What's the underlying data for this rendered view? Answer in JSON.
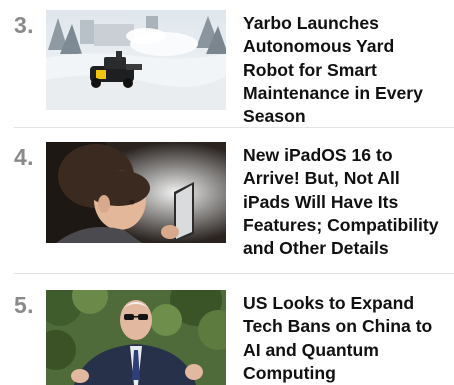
{
  "articles": [
    {
      "rank": "3.",
      "headline": "Yarbo Launches Autonomous Yard Robot for Smart Maintenance in Every Season",
      "thumbnail_icon": "snow-robot-photo"
    },
    {
      "rank": "4.",
      "headline": "New iPadOS 16 to Arrive! But, Not All iPads Will Have Its Features; Compatibility and Other Details",
      "thumbnail_icon": "child-ipad-photo"
    },
    {
      "rank": "5.",
      "headline": "US Looks to Expand Tech Bans on China to AI and Quantum Computing",
      "thumbnail_icon": "speaker-outdoors-photo"
    }
  ],
  "colors": {
    "rank": "#8a8a8a",
    "headline": "#111111",
    "divider": "#e3e3e3"
  }
}
